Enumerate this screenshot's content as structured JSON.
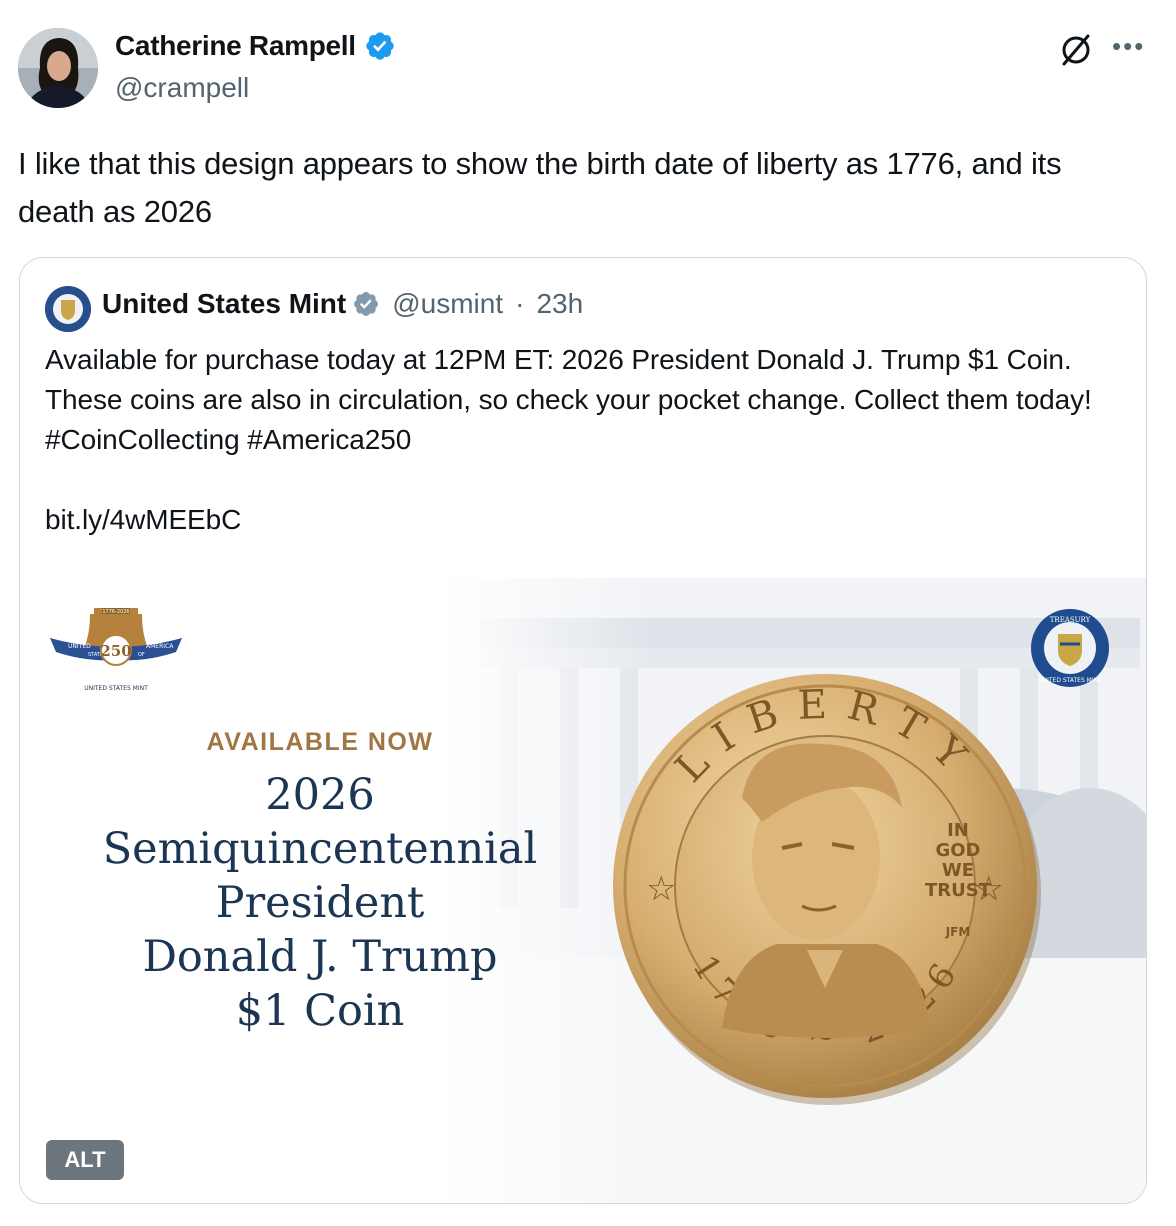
{
  "author": {
    "name": "Catherine Rampell",
    "handle": "@crampell",
    "avatar_icon": "profile-photo",
    "verified_color": "#1d9bf0"
  },
  "tweet": {
    "text": "I like that this design appears to show the birth date of liberty as 1776, and its death as 2026"
  },
  "quote": {
    "name": "United States Mint",
    "handle": "@usmint",
    "separator": "·",
    "time": "23h",
    "verified_color": "#829aab",
    "text": "Available for purchase today at 12PM ET: 2026 President Donald J. Trump $1 Coin. These coins are also in circulation, so check your pocket change. Collect them today! #CoinCollecting #America250\n\nbit.ly/4wMEEbC",
    "media": {
      "available": "AVAILABLE NOW",
      "lines": [
        "2026",
        "Semiquincentennial",
        "President",
        "Donald J. Trump",
        "$1 Coin"
      ],
      "bell_dates": "1776-2026",
      "bell_number": "250",
      "ribbon_left": "UNITED",
      "ribbon_states": "STATES",
      "ribbon_of": "OF",
      "ribbon_right": "AMERICA",
      "bell_caption": "UNITED STATES MINT",
      "seal_top": "TREASURY",
      "seal_bottom": "UNITED STATES MINT",
      "coin_liberty": "LIBERTY",
      "coin_motto": [
        "IN",
        "GOD",
        "WE",
        "TRUST"
      ],
      "coin_initials": "JFM",
      "coin_dates": "1776 ~ 2026",
      "alt": "ALT"
    }
  }
}
